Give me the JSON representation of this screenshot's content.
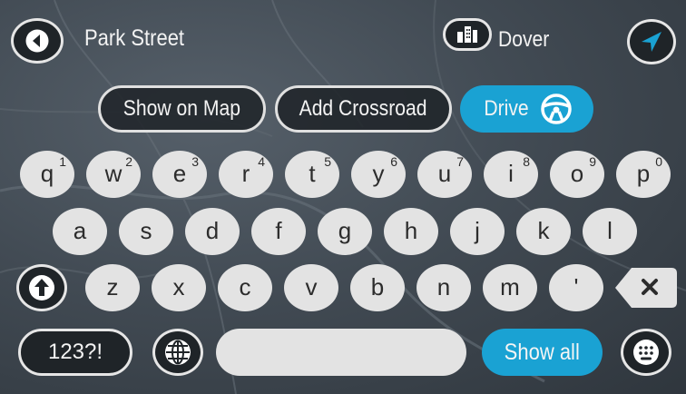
{
  "header": {
    "street": "Park Street",
    "city": "Dover"
  },
  "actions": {
    "show_on_map": "Show on Map",
    "add_crossroad": "Add Crossroad",
    "drive": "Drive"
  },
  "keyboard": {
    "row1": [
      {
        "ch": "q",
        "num": "1"
      },
      {
        "ch": "w",
        "num": "2"
      },
      {
        "ch": "e",
        "num": "3"
      },
      {
        "ch": "r",
        "num": "4"
      },
      {
        "ch": "t",
        "num": "5"
      },
      {
        "ch": "y",
        "num": "6"
      },
      {
        "ch": "u",
        "num": "7"
      },
      {
        "ch": "i",
        "num": "8"
      },
      {
        "ch": "o",
        "num": "9"
      },
      {
        "ch": "p",
        "num": "0"
      }
    ],
    "row2": [
      "a",
      "s",
      "d",
      "f",
      "g",
      "h",
      "j",
      "k",
      "l"
    ],
    "row3": [
      "z",
      "x",
      "c",
      "v",
      "b",
      "n",
      "m",
      "'"
    ],
    "numbers_key": "123?!",
    "show_all": "Show all"
  },
  "colors": {
    "accent": "#1aa2d3",
    "key": "#e3e3e3",
    "dark": "#1f2428"
  },
  "icons": {
    "back": "arrow-left-icon",
    "city": "city-buildings-icon",
    "navigate": "navigation-arrow-icon",
    "drive": "steering-wheel-icon",
    "shift": "shift-arrow-icon",
    "backspace": "backspace-icon",
    "language": "globe-icon",
    "hide_keyboard": "keyboard-icon"
  }
}
